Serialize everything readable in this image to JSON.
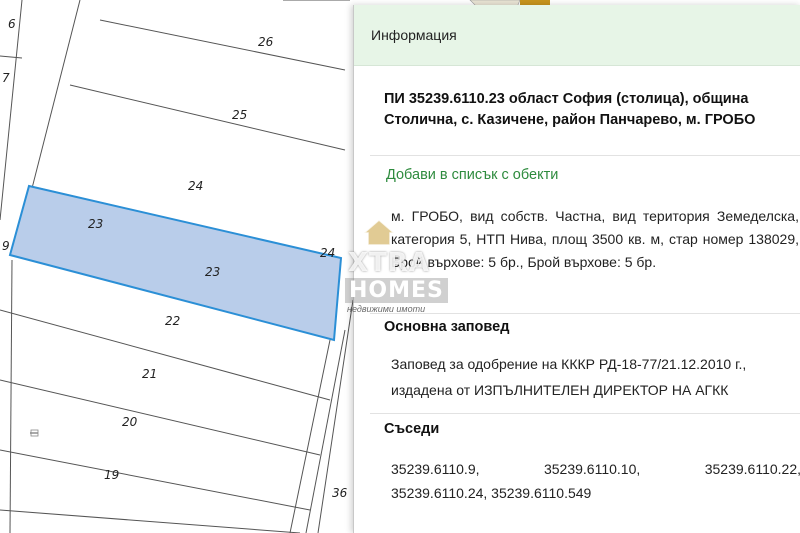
{
  "map": {
    "parcels": [
      {
        "id": "6",
        "label": "6"
      },
      {
        "id": "7",
        "label": "7"
      },
      {
        "id": "9",
        "label": "9"
      },
      {
        "id": "26",
        "label": "26"
      },
      {
        "id": "25",
        "label": "25"
      },
      {
        "id": "24",
        "label": "24"
      },
      {
        "id": "24b",
        "label": "24"
      },
      {
        "id": "23a",
        "label": "23"
      },
      {
        "id": "23b",
        "label": "23"
      },
      {
        "id": "22",
        "label": "22"
      },
      {
        "id": "21",
        "label": "21"
      },
      {
        "id": "20",
        "label": "20"
      },
      {
        "id": "19",
        "label": "19"
      },
      {
        "id": "36",
        "label": "36"
      }
    ],
    "selected_parcel": "23",
    "highlight_color": "#b9cdea",
    "highlight_border": "#2b8fd6"
  },
  "panel": {
    "header": "Информация",
    "title": "ПИ 35239.6110.23 област София (столица), община Столична, с. Казичене, район Панчарево, м. ГРОБО",
    "add_link": "Добави в списък с обекти",
    "description": "м. ГРОБО, вид собств. Частна, вид територия Земеделска, категория 5, НТП Нива, площ 3500 кв. м, стар номер 138029, Брой върхове: 5 бр., Брой върхове: 5 бр.",
    "order_heading": "Основна заповед",
    "order_text": "Заповед за одобрение на КККР РД-18-77/21.12.2010 г., издадена от ИЗПЪЛНИТЕЛЕН ДИРЕКТОР НА АГКК",
    "neighbors_heading": "Съседи",
    "neighbors_row1": [
      "35239.6110.9,",
      "35239.6110.10,",
      "35239.6110.22,"
    ],
    "neighbors_row2": "35239.6110.24, 35239.6110.549"
  },
  "watermark": {
    "brand_top": "XTRA",
    "brand_bottom": "HOMES",
    "tagline": "недвижими имоти"
  }
}
